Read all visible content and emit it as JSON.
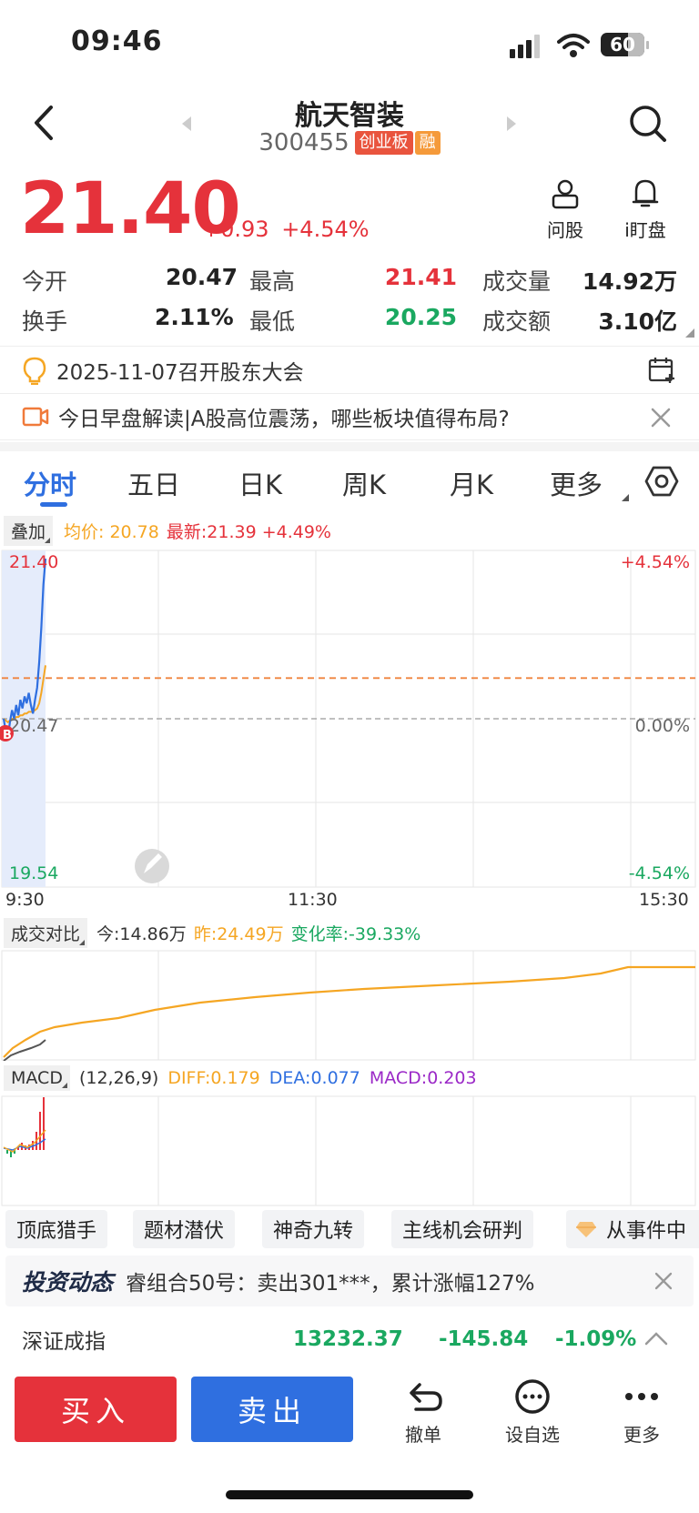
{
  "status_bar": {
    "time": "09:46",
    "battery": "60"
  },
  "header": {
    "title": "航天智装",
    "code": "300455",
    "tag_board": "创业板",
    "tag_margin": "融"
  },
  "quote": {
    "price": "21.40",
    "change": "+0.93",
    "change_pct": "+4.54%"
  },
  "actions": {
    "ask": "问股",
    "watch": "i盯盘"
  },
  "stats": {
    "open_label": "今开",
    "open": "20.47",
    "high_label": "最高",
    "high": "21.41",
    "vol_label": "成交量",
    "vol": "14.92万",
    "turnover_label": "换手",
    "turnover": "2.11%",
    "low_label": "最低",
    "low": "20.25",
    "amount_label": "成交额",
    "amount": "3.10亿"
  },
  "notices": {
    "meeting": "2025-11-07召开股东大会",
    "video": "今日早盘解读|A股高位震荡，哪些板块值得布局?"
  },
  "tabs": [
    "分时",
    "五日",
    "日K",
    "周K",
    "月K",
    "更多"
  ],
  "chart_header": {
    "overlay": "叠加",
    "avg": "均价: 20.78",
    "latest": "最新:21.39 +4.49%"
  },
  "chart_data": {
    "type": "line",
    "y_labels": {
      "top": "21.40",
      "mid": "20.47",
      "bottom": "19.54"
    },
    "pct_labels": {
      "top": "+4.54%",
      "mid": "0.00%",
      "bottom": "-4.54%"
    },
    "x_labels": [
      "9:30",
      "11:30",
      "15:30"
    ],
    "ylim": [
      19.54,
      21.4
    ],
    "prev_close": 20.47,
    "avg_price": 20.78,
    "price_series": [
      20.47,
      20.4,
      20.36,
      20.45,
      20.52,
      20.47,
      20.55,
      20.49,
      20.58,
      20.53,
      20.6,
      20.56,
      20.62,
      20.55,
      20.5,
      20.58,
      20.65,
      20.8,
      21.0,
      21.25,
      21.4
    ],
    "avg_series": [
      20.47,
      20.46,
      20.45,
      20.46,
      20.47,
      20.47,
      20.48,
      20.48,
      20.49,
      20.49,
      20.5,
      20.5,
      20.51,
      20.51,
      20.51,
      20.52,
      20.53,
      20.56,
      20.62,
      20.7,
      20.78
    ]
  },
  "volume": {
    "label": "成交对比",
    "today": "今:14.86万",
    "yesterday": "昨:24.49万",
    "rate": "变化率:-39.33%"
  },
  "macd": {
    "label": "MACD",
    "params": "(12,26,9)",
    "diff": "DIFF:0.179",
    "dea": "DEA:0.077",
    "macd": "MACD:0.203"
  },
  "features": [
    "顶底猎手",
    "题材潜伏",
    "神奇九转",
    "主线机会研判",
    "从事件中"
  ],
  "news": {
    "brand": "投资动态",
    "text": "睿组合50号：卖出301***，累计涨幅127%"
  },
  "index": {
    "name": "深证成指",
    "value": "13232.37",
    "change": "-145.84",
    "pct": "-1.09%"
  },
  "bottom": {
    "buy": "买入",
    "sell": "卖出",
    "cancel": "撤单",
    "add_watch": "设自选",
    "more": "更多"
  }
}
